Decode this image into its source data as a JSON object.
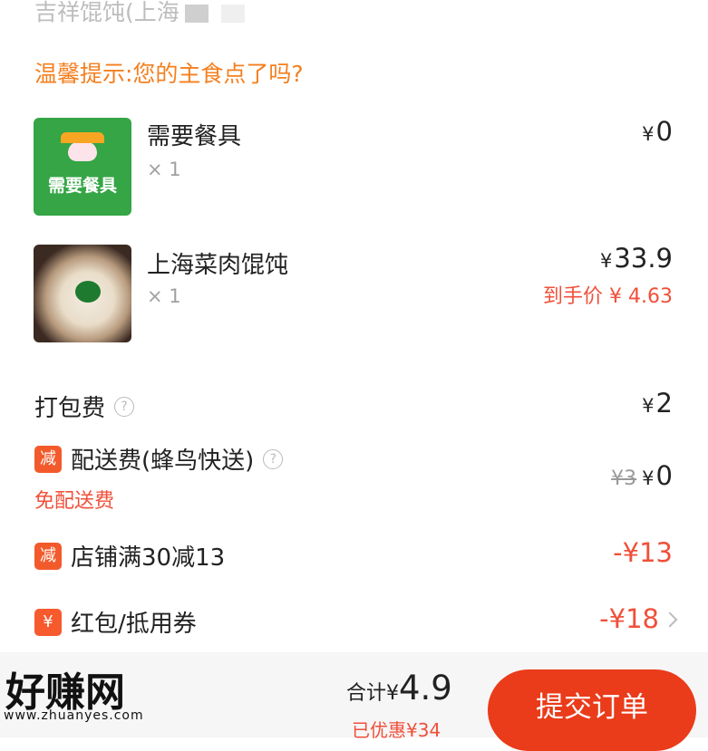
{
  "shop": {
    "name": "吉祥馄饨(上海"
  },
  "tip": "温馨提示:您的主食点了吗?",
  "items": [
    {
      "name": "需要餐具",
      "qty": "× 1",
      "price": "0",
      "image_label": "需要餐具"
    },
    {
      "name": "上海菜肉馄饨",
      "qty": "× 1",
      "price": "33.9",
      "net_price": "到手价 ¥ 4.63"
    }
  ],
  "currency": "¥",
  "fees": {
    "packing": {
      "label": "打包费",
      "amount": "2"
    },
    "delivery": {
      "badge": "减",
      "label": "配送费(蜂鸟快送)",
      "original": "¥3",
      "amount": "0",
      "note": "免配送费"
    },
    "store_discount": {
      "badge": "减",
      "label": "店铺满30减13",
      "amount": "-¥13"
    },
    "red_packet": {
      "badge": "¥",
      "label": "红包/抵用券",
      "amount": "-¥18"
    }
  },
  "help_glyph": "?",
  "footer": {
    "logo": "好赚网",
    "logo_sub": "www.zhuanyes.com",
    "total_label": "合计¥",
    "total_amount": "4.9",
    "saved": "已优惠¥34",
    "submit_label": "提交订单"
  },
  "colors": {
    "accent": "#ea3b1a",
    "tip": "#f57f1f",
    "discount": "#f0503a",
    "tableware_bg": "#35a545"
  }
}
